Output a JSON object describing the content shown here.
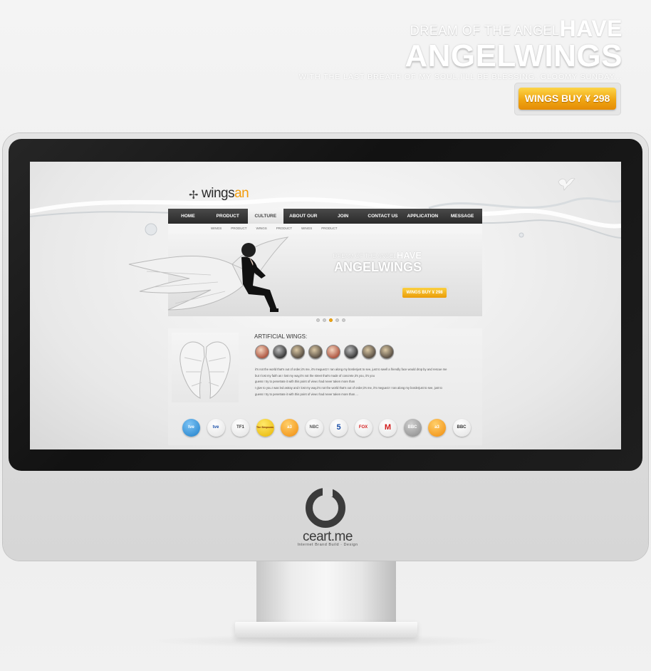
{
  "hero": {
    "line1_small": "DREAM OF THE ANGEL",
    "line1_big": "HAVE",
    "line2": "ANGELWINGS",
    "line3": "WITH THE LAST BREATH OF MY SOUL,I'LL BE BLESSING, GLOOMY SUNDAY...",
    "buy_label": "WINGS BUY ¥ 298"
  },
  "site": {
    "logo_main": "wings",
    "logo_accent": "an",
    "nav": [
      "HOME",
      "PRODUCT",
      "CULTURE",
      "ABOUT OUR",
      "JOIN",
      "CONTACT US",
      "APPLICATION",
      "MESSAGE"
    ],
    "nav_active": "CULTURE",
    "subnav": [
      "WINGS",
      "PRODUCT",
      "WINGS",
      "PRODUCT",
      "WINGS",
      "PRODUCT"
    ],
    "banner": {
      "line1_small": "DREAM OF THE ANGEL",
      "line1_big": "HAVE",
      "line2": "ANGELWINGS",
      "buy_label": "WINGS BUY ¥ 298"
    },
    "slider_dots": 5,
    "slider_active": 3,
    "section_title": "ARTIFICIAL WINGS:",
    "paragraph": [
      "it's not the world that's out of order,it's me, it's meguezz I ran along my borderjust to see, just to swell a friendly face would drop by and rescue me",
      "but I lost my faith as I lost my way,it's not the street that's made of concrete,it's you, it's you",
      "guess I try to penetrate it with this point of view.I had never taken more than",
      "I give to you.I was led astray and I lost my way.it's not the world that's out of order,it's me, it's meguezz I ran along my borderjust to see, just to",
      "guess I try to penetrate it with this point of view.I had never taken more than ..."
    ],
    "partner_logos": [
      "tve",
      "tve",
      "TF1",
      "The Simpsons",
      "a3",
      "NBC",
      "5",
      "FOX",
      "M",
      "BBC",
      "a3",
      "BBC"
    ]
  },
  "brand": {
    "name": "ceart.me",
    "tagline": "Internet Brand Build · Design"
  }
}
